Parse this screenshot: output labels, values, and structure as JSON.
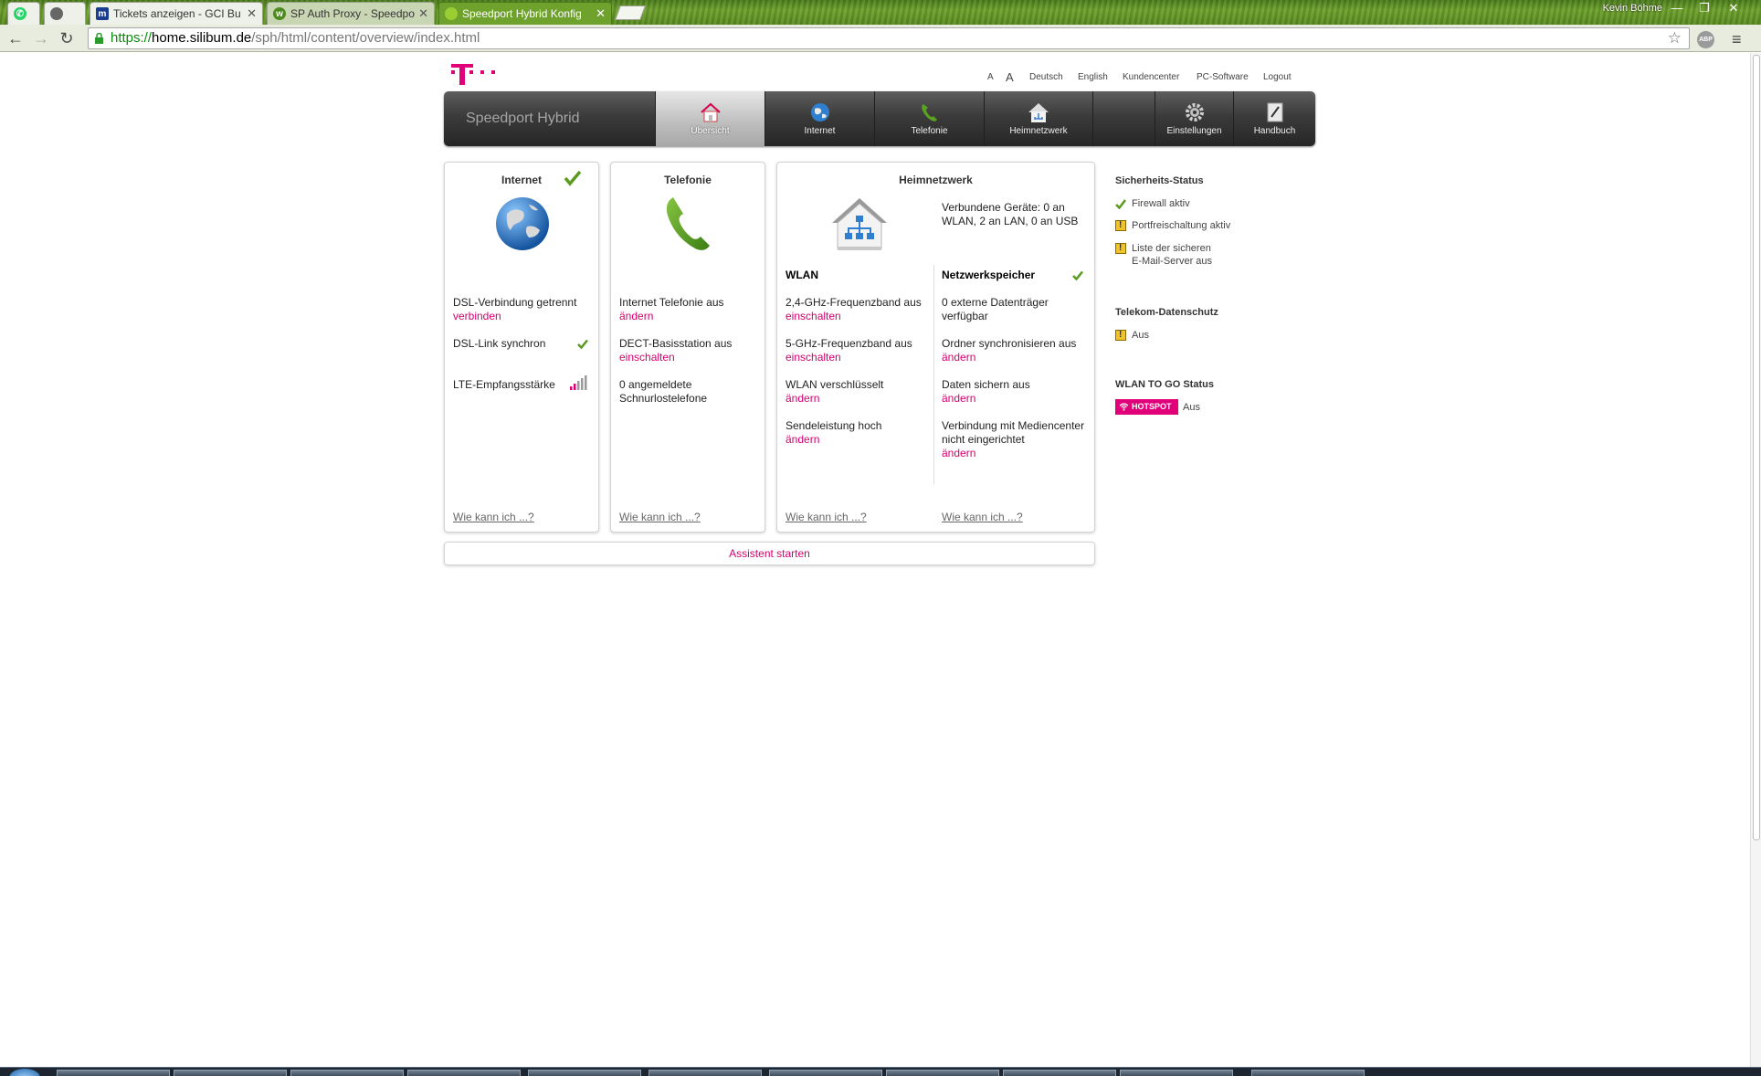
{
  "browser": {
    "tabs": [
      {
        "title": "",
        "icon": "whatsapp-icon",
        "color": "#25d366"
      },
      {
        "title": "",
        "icon": "apple-icon",
        "color": "#555555"
      },
      {
        "title": "Tickets anzeigen - GCI Bu",
        "icon": "m-logo-icon",
        "color": "#1a3d8f"
      },
      {
        "title": "SP Auth Proxy - Speedpo",
        "icon": "w-logo-icon",
        "color": "#4c8a1e"
      },
      {
        "title": "Speedport Hybrid Konfig",
        "icon": "speedport-icon",
        "color": "#6ea22d"
      }
    ],
    "user": "Kevin Böhme",
    "window_controls": {
      "minimize": "—",
      "maximize": "❐",
      "close": "✕"
    },
    "url": {
      "scheme": "https://",
      "host": "home.silibum.de",
      "path": "/sph/html/content/overview/index.html"
    },
    "back": "←",
    "forward": "→",
    "reload": "↻",
    "star": "☆",
    "abp": "ABP",
    "menu": "≡"
  },
  "topnav": {
    "font_small": "A",
    "font_large": "A",
    "deutsch": "Deutsch",
    "english": "English",
    "kundencenter": "Kundencenter",
    "pcsoftware": "PC-Software",
    "logout": "Logout"
  },
  "mainnav": {
    "brand": "Speedport Hybrid",
    "items": [
      {
        "label": "Übersicht",
        "icon": "house-icon"
      },
      {
        "label": "Internet",
        "icon": "globe-icon"
      },
      {
        "label": "Telefonie",
        "icon": "phone-icon"
      },
      {
        "label": "Heimnetzwerk",
        "icon": "home-network-icon"
      },
      {
        "label": "Einstellungen",
        "icon": "gear-icon"
      },
      {
        "label": "Handbuch",
        "icon": "manual-icon"
      }
    ]
  },
  "internet_card": {
    "title": "Internet",
    "dsl_status": "DSL-Verbindung getrennt",
    "dsl_action": "verbinden",
    "dsl_link": "DSL-Link synchron",
    "lte": "LTE-Empfangsstärke",
    "lte_bars": 5,
    "lte_active_bars": 2,
    "howto": "Wie kann ich ...?"
  },
  "telefonie_card": {
    "title": "Telefonie",
    "internet_tel": "Internet Telefonie aus",
    "internet_tel_action": "ändern",
    "dect": "DECT-Basisstation aus",
    "dect_action": "einschalten",
    "handsets": "0 angemeldete Schnurlostelefone",
    "howto": "Wie kann ich ...?"
  },
  "heimnetz_card": {
    "title": "Heimnetzwerk",
    "devices": "Verbundene Geräte: 0 an WLAN, 2 an LAN, 0 an USB",
    "wlan_head": "WLAN",
    "wlan": [
      {
        "text": "2,4-GHz-Frequenzband aus",
        "action": "einschalten"
      },
      {
        "text": "5-GHz-Frequenzband aus",
        "action": "einschalten"
      },
      {
        "text": "WLAN verschlüsselt",
        "action": "ändern"
      },
      {
        "text": "Sendeleistung hoch",
        "action": "ändern"
      }
    ],
    "nas_head": "Netzwerkspeicher",
    "nas": [
      {
        "text": "0 externe Datenträger verfügbar",
        "action": ""
      },
      {
        "text": "Ordner synchronisieren aus",
        "action": "ändern"
      },
      {
        "text": "Daten sichern aus",
        "action": "ändern"
      },
      {
        "text": "Verbindung mit Mediencenter nicht eingerichtet",
        "action": "ändern"
      }
    ],
    "howto_left": "Wie kann ich ...?",
    "howto_right": "Wie kann ich ...?"
  },
  "assistant": "Assistent starten",
  "sidebar": {
    "security_head": "Sicherheits-Status",
    "firewall": "Firewall aktiv",
    "portfw": "Portfreischaltung aktiv",
    "mailserver": "Liste der sicheren E-Mail-Server aus",
    "privacy_head": "Telekom-Datenschutz",
    "privacy": "Aus",
    "wlantogo_head": "WLAN TO GO Status",
    "hotspot": "HOTSPOT",
    "hotspot_status": "Aus"
  },
  "colors": {
    "magenta": "#e2007a",
    "link": "#d4006e",
    "green": "#5a9a1e",
    "nav_dark": "#2f2f2f"
  }
}
